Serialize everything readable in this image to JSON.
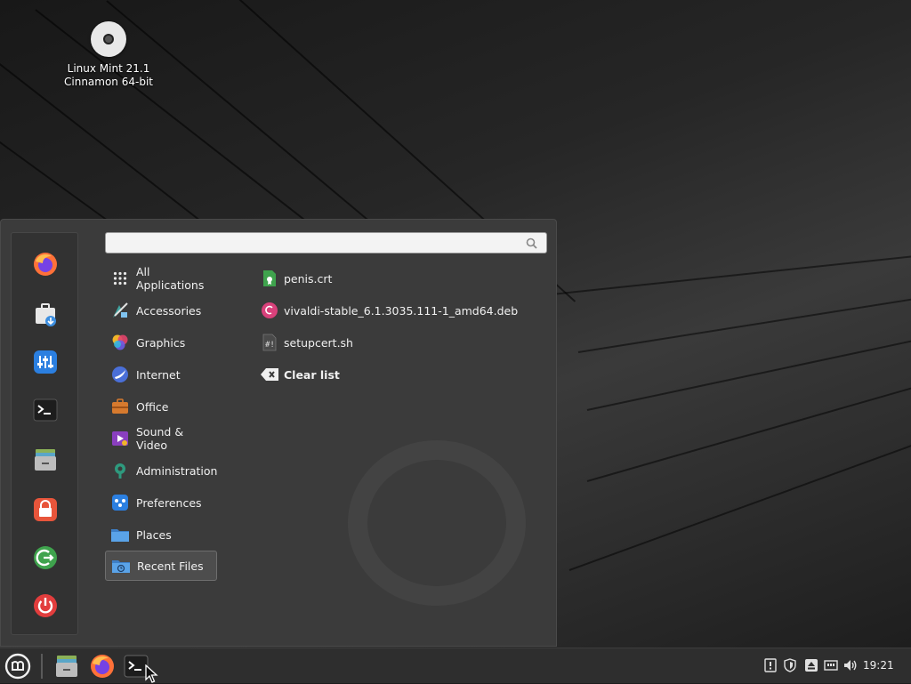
{
  "desktop": {
    "icon_label_line1": "Linux Mint 21.1",
    "icon_label_line2": "Cinnamon 64-bit",
    "icon_name": "optical-disc-icon"
  },
  "menu": {
    "search": {
      "value": "",
      "placeholder": ""
    },
    "favorites": [
      {
        "name": "firefox-icon"
      },
      {
        "name": "software-manager-icon"
      },
      {
        "name": "system-settings-icon"
      },
      {
        "name": "terminal-icon"
      },
      {
        "name": "files-icon"
      },
      {
        "name": "lock-screen-icon"
      },
      {
        "name": "logout-icon"
      },
      {
        "name": "power-icon"
      }
    ],
    "categories": [
      {
        "label": "All Applications",
        "icon": "grid-icon"
      },
      {
        "label": "Accessories",
        "icon": "accessories-icon"
      },
      {
        "label": "Graphics",
        "icon": "graphics-icon"
      },
      {
        "label": "Internet",
        "icon": "internet-icon"
      },
      {
        "label": "Office",
        "icon": "office-icon"
      },
      {
        "label": "Sound & Video",
        "icon": "sound-video-icon"
      },
      {
        "label": "Administration",
        "icon": "administration-icon"
      },
      {
        "label": "Preferences",
        "icon": "preferences-icon"
      },
      {
        "label": "Places",
        "icon": "folder-icon"
      },
      {
        "label": "Recent Files",
        "icon": "recent-folder-icon",
        "selected": true
      }
    ],
    "recent_files": [
      {
        "label": "penis.crt",
        "icon": "certificate-file-icon"
      },
      {
        "label": "vivaldi-stable_6.1.3035.111-1_amd64.deb",
        "icon": "debian-package-icon"
      },
      {
        "label": "setupcert.sh",
        "icon": "shell-script-icon"
      }
    ],
    "clear_list_label": "Clear list"
  },
  "panel": {
    "clock": "19:21",
    "launchers": [
      "files-icon",
      "firefox-icon",
      "terminal-icon"
    ],
    "tray": [
      "update-manager-icon",
      "shield-icon",
      "eject-icon",
      "network-icon",
      "volume-icon"
    ]
  },
  "colors": {
    "menu_bg": "#3b3b3b",
    "panel_bg": "#2e2e2e",
    "mint_green": "#8bb158",
    "text": "#f0f0f0"
  }
}
